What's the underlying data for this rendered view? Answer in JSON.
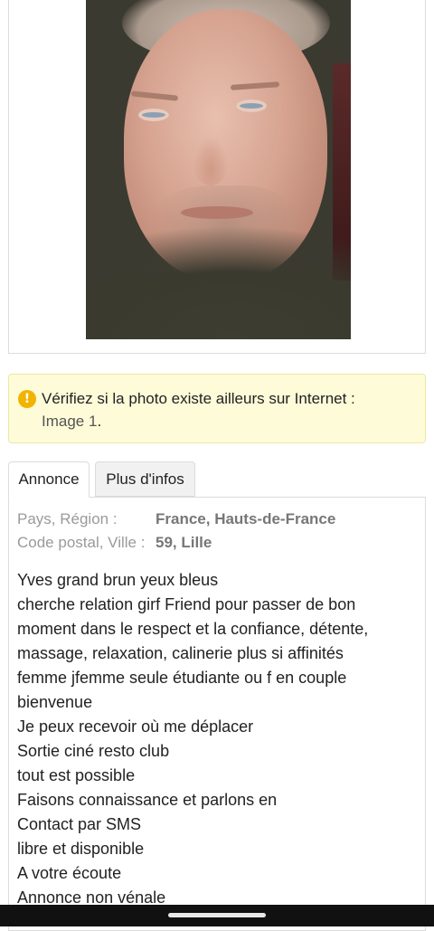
{
  "photo": {
    "alt": "profile-photo"
  },
  "alert": {
    "icon": "info-icon",
    "text": "Vérifiez si la photo existe ailleurs sur Internet :",
    "link": "Image 1",
    "link_suffix": "."
  },
  "tabs": [
    {
      "label": "Annonce",
      "active": true
    },
    {
      "label": "Plus d'infos",
      "active": false
    }
  ],
  "info": [
    {
      "label": "Pays, Région :",
      "value": "France, Hauts-de-France"
    },
    {
      "label": "Code postal, Ville :",
      "value": "59, Lille"
    }
  ],
  "description": [
    "Yves grand brun yeux bleus",
    "cherche relation girf Friend pour passer de bon",
    "moment dans le respect et la confiance, détente,",
    "massage, relaxation, calinerie plus si affinités",
    "femme jfemme seule étudiante ou f en couple",
    "bienvenue",
    "Je peux recevoir où me déplacer",
    "Sortie ciné resto club",
    "tout est possible",
    "Faisons connaissance et parlons en",
    "Contact par SMS",
    "libre et disponible",
    "A votre écoute",
    "Annonce non vénale"
  ],
  "colors": {
    "alert_bg": "#fdfbd8",
    "info_icon": "#f0b400"
  }
}
